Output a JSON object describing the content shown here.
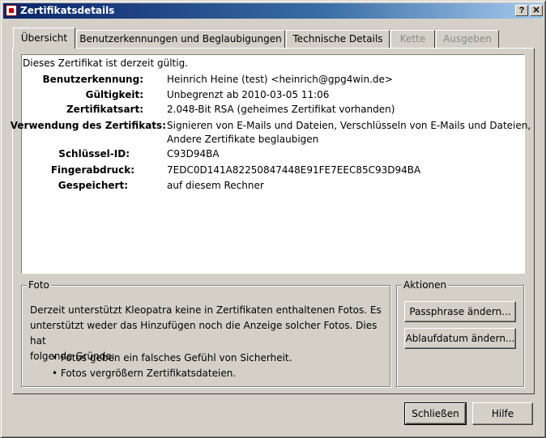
{
  "window": {
    "title": "Zertifikatsdetails",
    "help_button": "?",
    "close_button": "✕"
  },
  "tabs": [
    {
      "label": "Übersicht",
      "active": true,
      "enabled": true
    },
    {
      "label": "Benutzerkennungen und Beglaubigungen",
      "active": false,
      "enabled": true
    },
    {
      "label": "Technische Details",
      "active": false,
      "enabled": true
    },
    {
      "label": "Kette",
      "active": false,
      "enabled": false
    },
    {
      "label": "Ausgeben",
      "active": false,
      "enabled": false
    }
  ],
  "overview": {
    "status": "Dieses Zertifikat ist derzeit gültig.",
    "rows": [
      {
        "label": "Benutzerkennung:",
        "value": "Heinrich Heine (test) <heinrich@gpg4win.de>"
      },
      {
        "label": "Gültigkeit:",
        "value": "Unbegrenzt ab 2010-03-05 11:06"
      },
      {
        "label": "Zertifikatsart:",
        "value": "2.048-Bit RSA (geheimes Zertifikat vorhanden)"
      },
      {
        "label": "Verwendung des Zertifikats:",
        "value_line1": "Signieren von E-Mails und Dateien, Verschlüsseln von E-Mails und Dateien,",
        "value_line2": "Andere Zertifikate beglaubigen"
      },
      {
        "label": "Schlüssel-ID:",
        "value": "C93D94BA"
      },
      {
        "label": "Fingerabdruck:",
        "value": "7EDC0D141A82250847448E91FE7EEC85C93D94BA"
      },
      {
        "label": "Gespeichert:",
        "value": "auf diesem Rechner"
      }
    ]
  },
  "foto": {
    "title": "Foto",
    "line1": "Derzeit unterstützt Kleopatra keine in Zertifikaten enthaltenen Fotos. Es",
    "line2": "unterstützt weder das Hinzufügen noch die Anzeige solcher Fotos. Dies hat",
    "line3": "folgende Gründe:",
    "bullets": [
      "• Fotos geben ein falsches Gefühl von Sicherheit.",
      "• Fotos vergrößern Zertifikatsdateien."
    ]
  },
  "actions": {
    "title": "Aktionen",
    "change_passphrase": "Passphrase ändern...",
    "change_expiry": "Ablaufdatum ändern..."
  },
  "footer": {
    "close": "Schließen",
    "help": "Hilfe"
  }
}
